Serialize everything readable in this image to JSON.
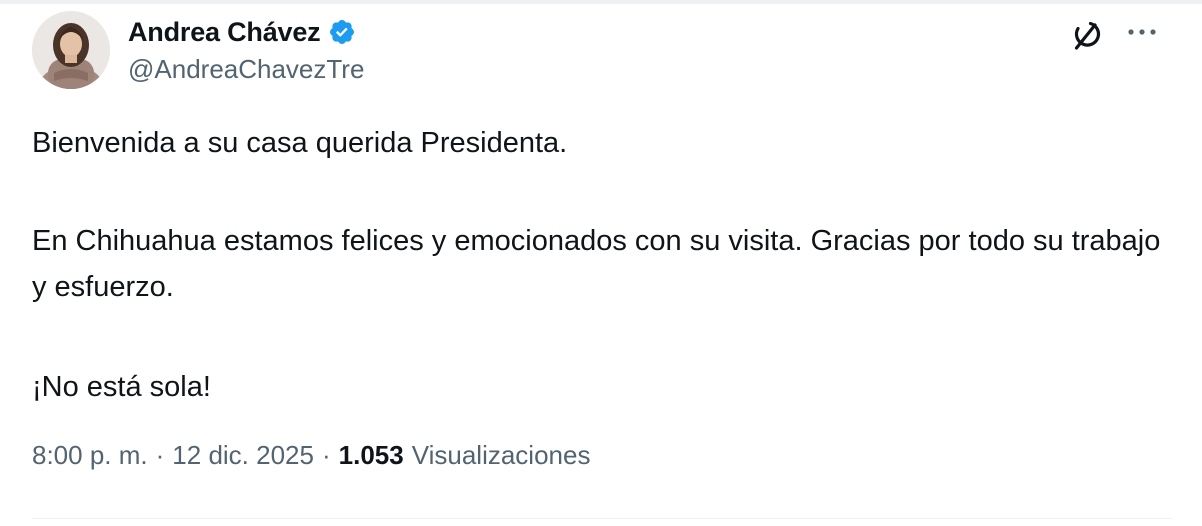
{
  "author": {
    "display_name": "Andrea Chávez",
    "handle": "@AndreaChavezTre",
    "verified": true
  },
  "icons": {
    "verified": "verified-badge-icon",
    "grok": "grok-icon",
    "more": "more-icon"
  },
  "tweet": {
    "paragraphs": [
      "Bienvenida a su casa querida Presidenta.",
      "En Chihuahua estamos felices y emocionados con su visita. Gracias por todo su trabajo y esfuerzo.",
      "¡No está sola!"
    ]
  },
  "meta": {
    "time": "8:00 p. m.",
    "separator": "·",
    "date": "12 dic. 2025",
    "views_count": "1.053",
    "views_label": "Visualizaciones"
  },
  "colors": {
    "verified_blue": "#1d9bf0",
    "text_primary": "#0f1419",
    "text_secondary": "#536471"
  }
}
